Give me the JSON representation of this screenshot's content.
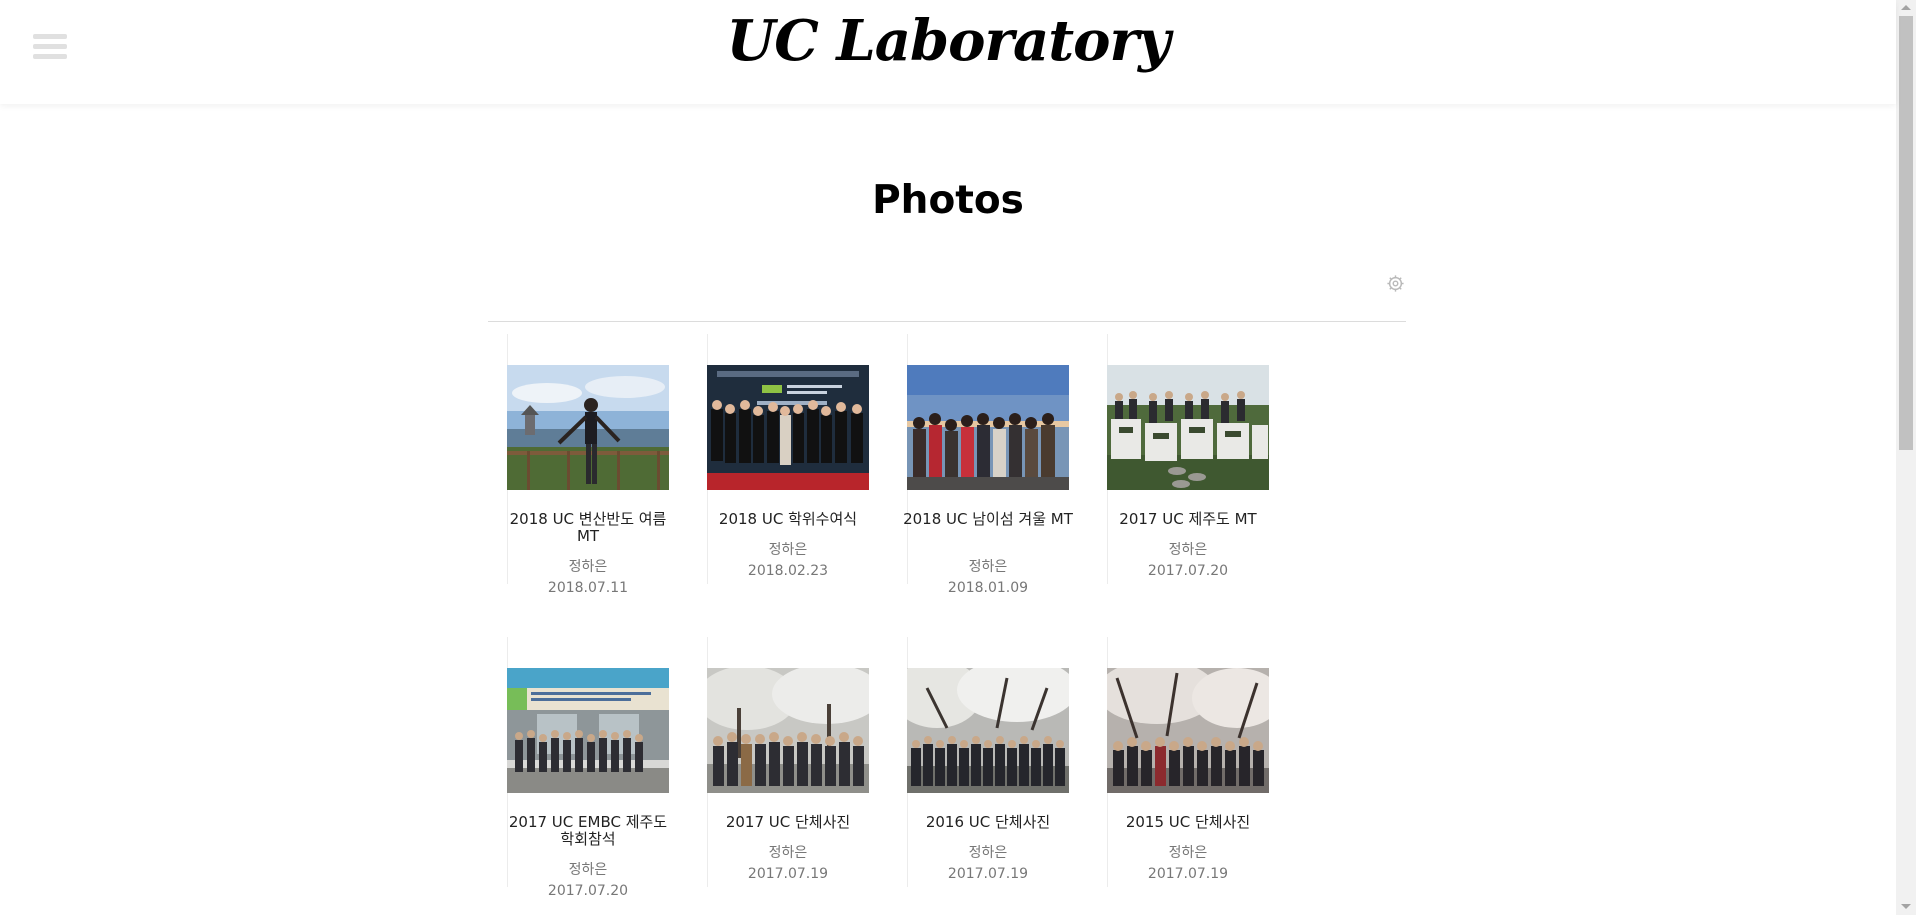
{
  "header": {
    "site_title": "UC Laboratory",
    "menu_icon": "hamburger-menu-icon"
  },
  "page": {
    "title": "Photos",
    "settings_icon": "gear-icon"
  },
  "albums": [
    {
      "title": "2018 UC 변산반도 여름 MT",
      "author": "정하은",
      "date": "2018.07.11",
      "thumbnail": "person-on-railing-by-sea-photo"
    },
    {
      "title": "2018 UC 학위수여식",
      "author": "정하은",
      "date": "2018.02.23",
      "thumbnail": "graduation-group-photo"
    },
    {
      "title": "2018 UC 남이섬 겨울 MT",
      "author": "정하은",
      "date": "2018.01.09",
      "thumbnail": "group-by-lake-photo"
    },
    {
      "title": "2017 UC 제주도 MT",
      "author": "정하은",
      "date": "2017.07.20",
      "thumbnail": "group-on-letter-sign-photo"
    },
    {
      "title": "2017 UC EMBC 제주도 학회참석",
      "author": "정하은",
      "date": "2017.07.20",
      "thumbnail": "conference-group-photo"
    },
    {
      "title": "2017 UC 단체사진",
      "author": "정하은",
      "date": "2017.07.19",
      "thumbnail": "cherry-blossom-group-photo"
    },
    {
      "title": "2016 UC 단체사진",
      "author": "정하은",
      "date": "2017.07.19",
      "thumbnail": "cherry-blossom-group-photo"
    },
    {
      "title": "2015 UC 단체사진",
      "author": "정하은",
      "date": "2017.07.19",
      "thumbnail": "cherry-blossom-group-photo"
    }
  ]
}
